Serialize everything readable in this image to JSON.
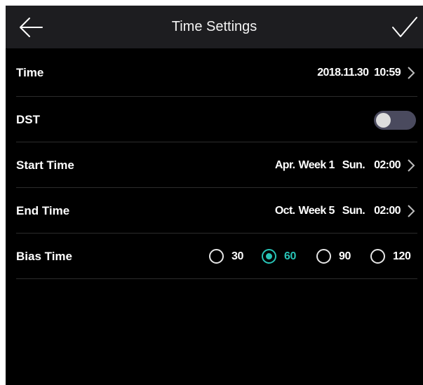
{
  "header": {
    "title": "Time Settings"
  },
  "rows": {
    "time": {
      "label": "Time",
      "value": "2018.11.30  10:59"
    },
    "dst": {
      "label": "DST",
      "enabled": false
    },
    "start_time": {
      "label": "Start Time",
      "month": "Apr.",
      "week": "Week 1",
      "day": "Sun.",
      "time": "02:00"
    },
    "end_time": {
      "label": "End Time",
      "month": "Oct.",
      "week": "Week 5",
      "day": "Sun.",
      "time": "02:00"
    },
    "bias_time": {
      "label": "Bias Time",
      "options": [
        "30",
        "60",
        "90",
        "120"
      ],
      "selected": "60"
    }
  },
  "colors": {
    "background": "#000000",
    "header_bg": "#1d1d20",
    "accent": "#28c3b6",
    "toggle_off": "#4a4a5e",
    "divider": "#2c2c2c"
  },
  "icons": {
    "back": "back-arrow-icon",
    "confirm": "checkmark-icon",
    "chevron": "chevron-right-icon"
  }
}
